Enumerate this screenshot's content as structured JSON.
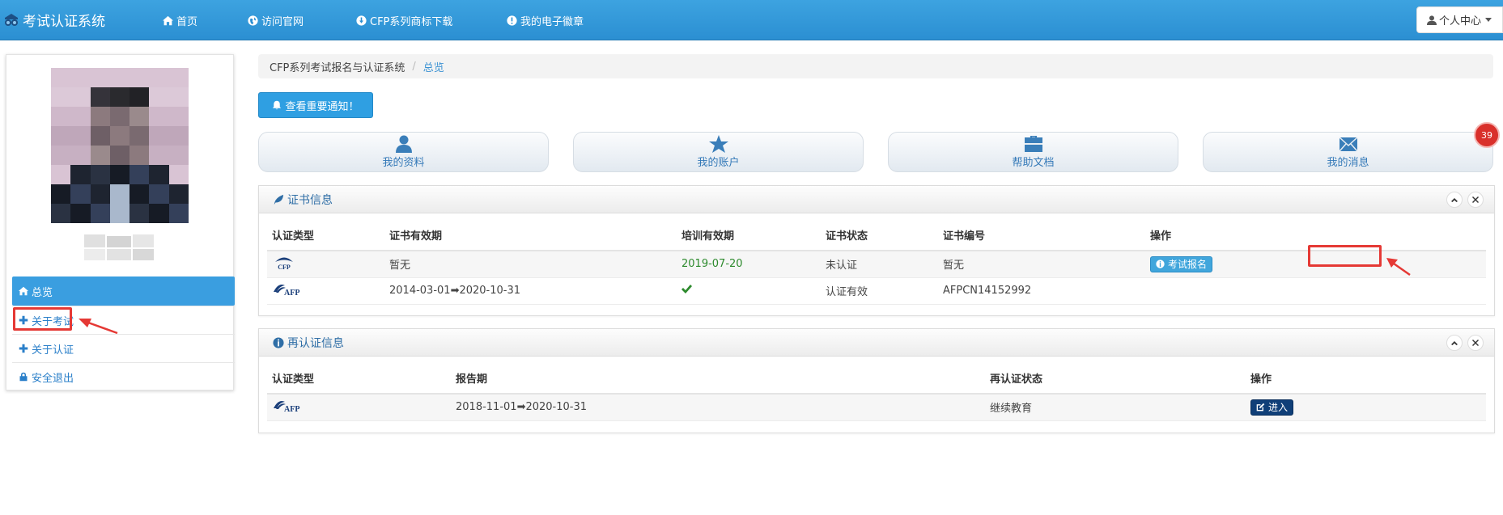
{
  "navbar": {
    "brand": "考试认证系统",
    "items": [
      {
        "label": "首页",
        "icon": "home-icon"
      },
      {
        "label": "访问官网",
        "icon": "globe-icon"
      },
      {
        "label": "CFP系列商标下载",
        "icon": "download-icon"
      },
      {
        "label": "我的电子徽章",
        "icon": "badge-icon"
      }
    ],
    "user_menu": "个人中心"
  },
  "sidebar": {
    "menu": [
      {
        "label": "总览",
        "icon": "home-icon",
        "active": true
      },
      {
        "label": "关于考试",
        "icon": "plus-icon"
      },
      {
        "label": "关于认证",
        "icon": "plus-icon"
      },
      {
        "label": "安全退出",
        "icon": "lock-icon"
      }
    ]
  },
  "breadcrumb": {
    "root": "CFP系列考试报名与认证系统",
    "current": "总览"
  },
  "notice_button": "查看重要通知！",
  "tiles": [
    {
      "label": "我的资料",
      "icon": "user-icon"
    },
    {
      "label": "我的账户",
      "icon": "star-icon"
    },
    {
      "label": "帮助文档",
      "icon": "briefcase-icon"
    },
    {
      "label": "我的消息",
      "icon": "envelope-icon"
    }
  ],
  "message_badge": "39",
  "cert_panel": {
    "title": "证书信息",
    "headers": [
      "认证类型",
      "证书有效期",
      "培训有效期",
      "证书状态",
      "证书编号",
      "操作"
    ],
    "rows": [
      {
        "type_logo": "CFP",
        "cert_valid": "暂无",
        "train_valid": "2019-07-20",
        "status": "未认证",
        "number": "暂无",
        "action": "考试报名"
      },
      {
        "type_logo": "AFP",
        "cert_valid_from": "2014-03-01",
        "cert_valid_to": "2020-10-31",
        "train_valid": "check",
        "status": "认证有效",
        "number": "AFPCN14152992",
        "action": ""
      }
    ]
  },
  "recert_panel": {
    "title": "再认证信息",
    "headers": [
      "认证类型",
      "报告期",
      "再认证状态",
      "操作"
    ],
    "rows": [
      {
        "type_logo": "AFP",
        "period_from": "2018-11-01",
        "period_to": "2020-10-31",
        "status": "继续教育",
        "action": "进入"
      }
    ]
  },
  "colors": {
    "navbar": "#2b8fd2",
    "accent": "#3a9ee0",
    "highlight": "#e53935",
    "badge": "#d9302b"
  }
}
